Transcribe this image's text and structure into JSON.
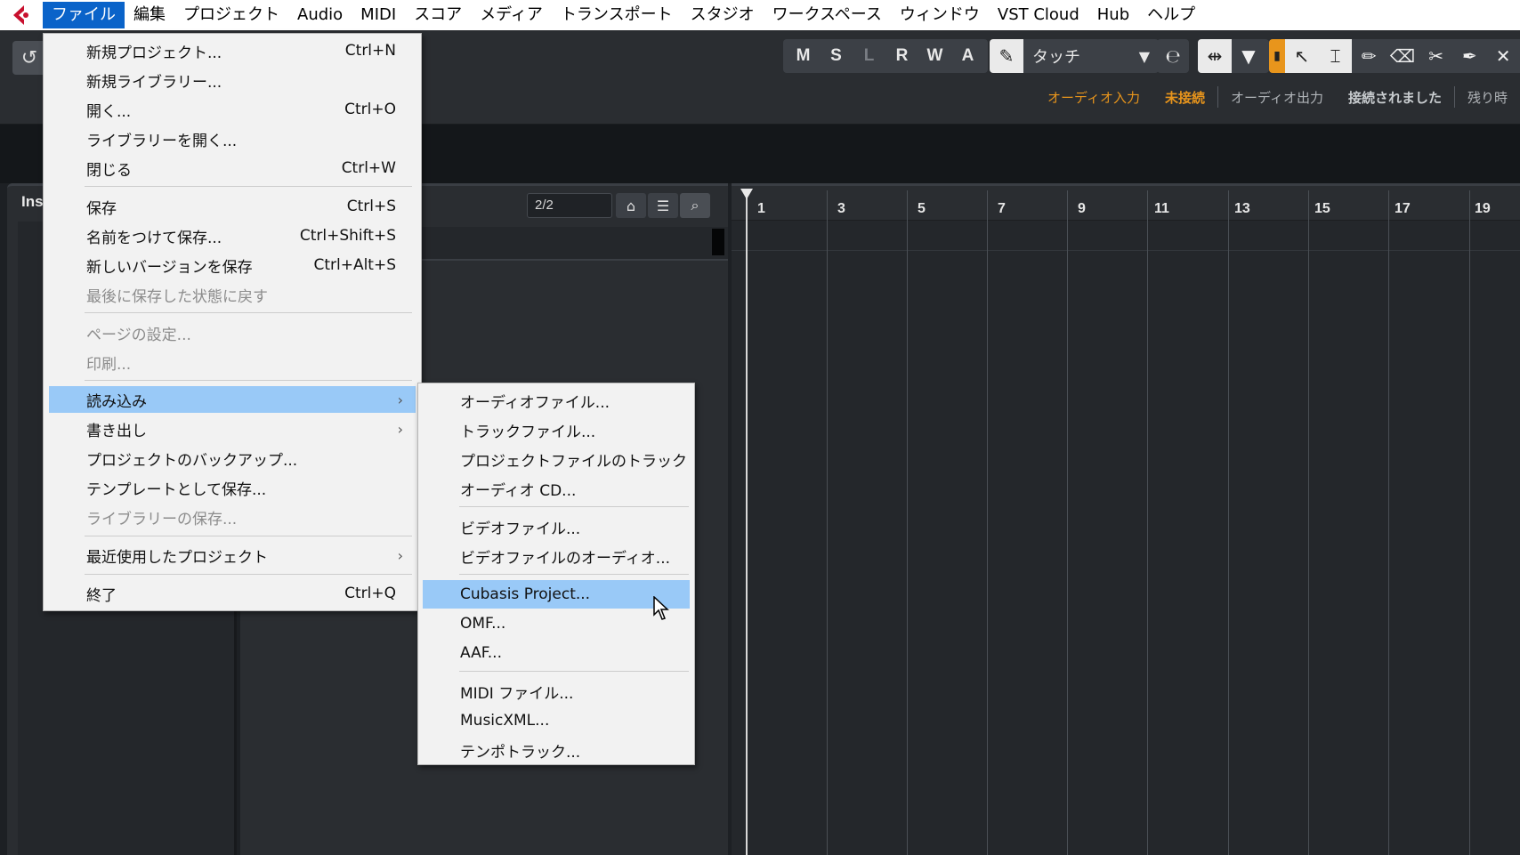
{
  "menubar": {
    "items": [
      "ファイル",
      "編集",
      "プロジェクト",
      "Audio",
      "MIDI",
      "スコア",
      "メディア",
      "トランスポート",
      "スタジオ",
      "ワークスペース",
      "ウィンドウ",
      "VST Cloud",
      "Hub",
      "ヘルプ"
    ],
    "active_index": 0
  },
  "toolbar": {
    "modes": [
      "M",
      "S",
      "L",
      "R",
      "W",
      "A"
    ],
    "automation_mode": "タッチ",
    "status": {
      "audio_in_label": "オーディオ入力",
      "audio_in_state": "未接続",
      "audio_out_label": "オーディオ出力",
      "audio_out_state": "接続されました",
      "remaining_label": "残り時"
    }
  },
  "inspector": {
    "label": "Ins"
  },
  "tracklist": {
    "counter": "2/2"
  },
  "ruler": {
    "bars": [
      "1",
      "3",
      "5",
      "7",
      "9",
      "11",
      "13",
      "15",
      "17",
      "19"
    ]
  },
  "file_menu": {
    "items": [
      {
        "label": "新規プロジェクト...",
        "shortcut": "Ctrl+N"
      },
      {
        "label": "新規ライブラリー...",
        "shortcut": ""
      },
      {
        "label": "開く...",
        "shortcut": "Ctrl+O"
      },
      {
        "label": "ライブラリーを開く...",
        "shortcut": ""
      },
      {
        "label": "閉じる",
        "shortcut": "Ctrl+W"
      },
      {
        "label": "保存",
        "shortcut": "Ctrl+S"
      },
      {
        "label": "名前をつけて保存...",
        "shortcut": "Ctrl+Shift+S"
      },
      {
        "label": "新しいバージョンを保存",
        "shortcut": "Ctrl+Alt+S"
      },
      {
        "label": "最後に保存した状態に戻す",
        "shortcut": ""
      },
      {
        "label": "ページの設定...",
        "shortcut": ""
      },
      {
        "label": "印刷...",
        "shortcut": ""
      },
      {
        "label": "読み込み",
        "shortcut": ""
      },
      {
        "label": "書き出し",
        "shortcut": ""
      },
      {
        "label": "プロジェクトのバックアップ...",
        "shortcut": ""
      },
      {
        "label": "テンプレートとして保存...",
        "shortcut": ""
      },
      {
        "label": "ライブラリーの保存...",
        "shortcut": ""
      },
      {
        "label": "最近使用したプロジェクト",
        "shortcut": ""
      },
      {
        "label": "終了",
        "shortcut": "Ctrl+Q"
      }
    ]
  },
  "import_submenu": {
    "items": [
      "オーディオファイル...",
      "トラックファイル...",
      "プロジェクトファイルのトラック",
      "オーディオ CD...",
      "ビデオファイル...",
      "ビデオファイルのオーディオ...",
      "Cubasis Project...",
      "OMF...",
      "AAF...",
      "MIDI ファイル...",
      "MusicXML...",
      "テンポトラック..."
    ]
  },
  "colors": {
    "menu_highlight": "#99c9f7",
    "menubar_active": "#0a63c9",
    "accent_orange": "#e8951c"
  }
}
